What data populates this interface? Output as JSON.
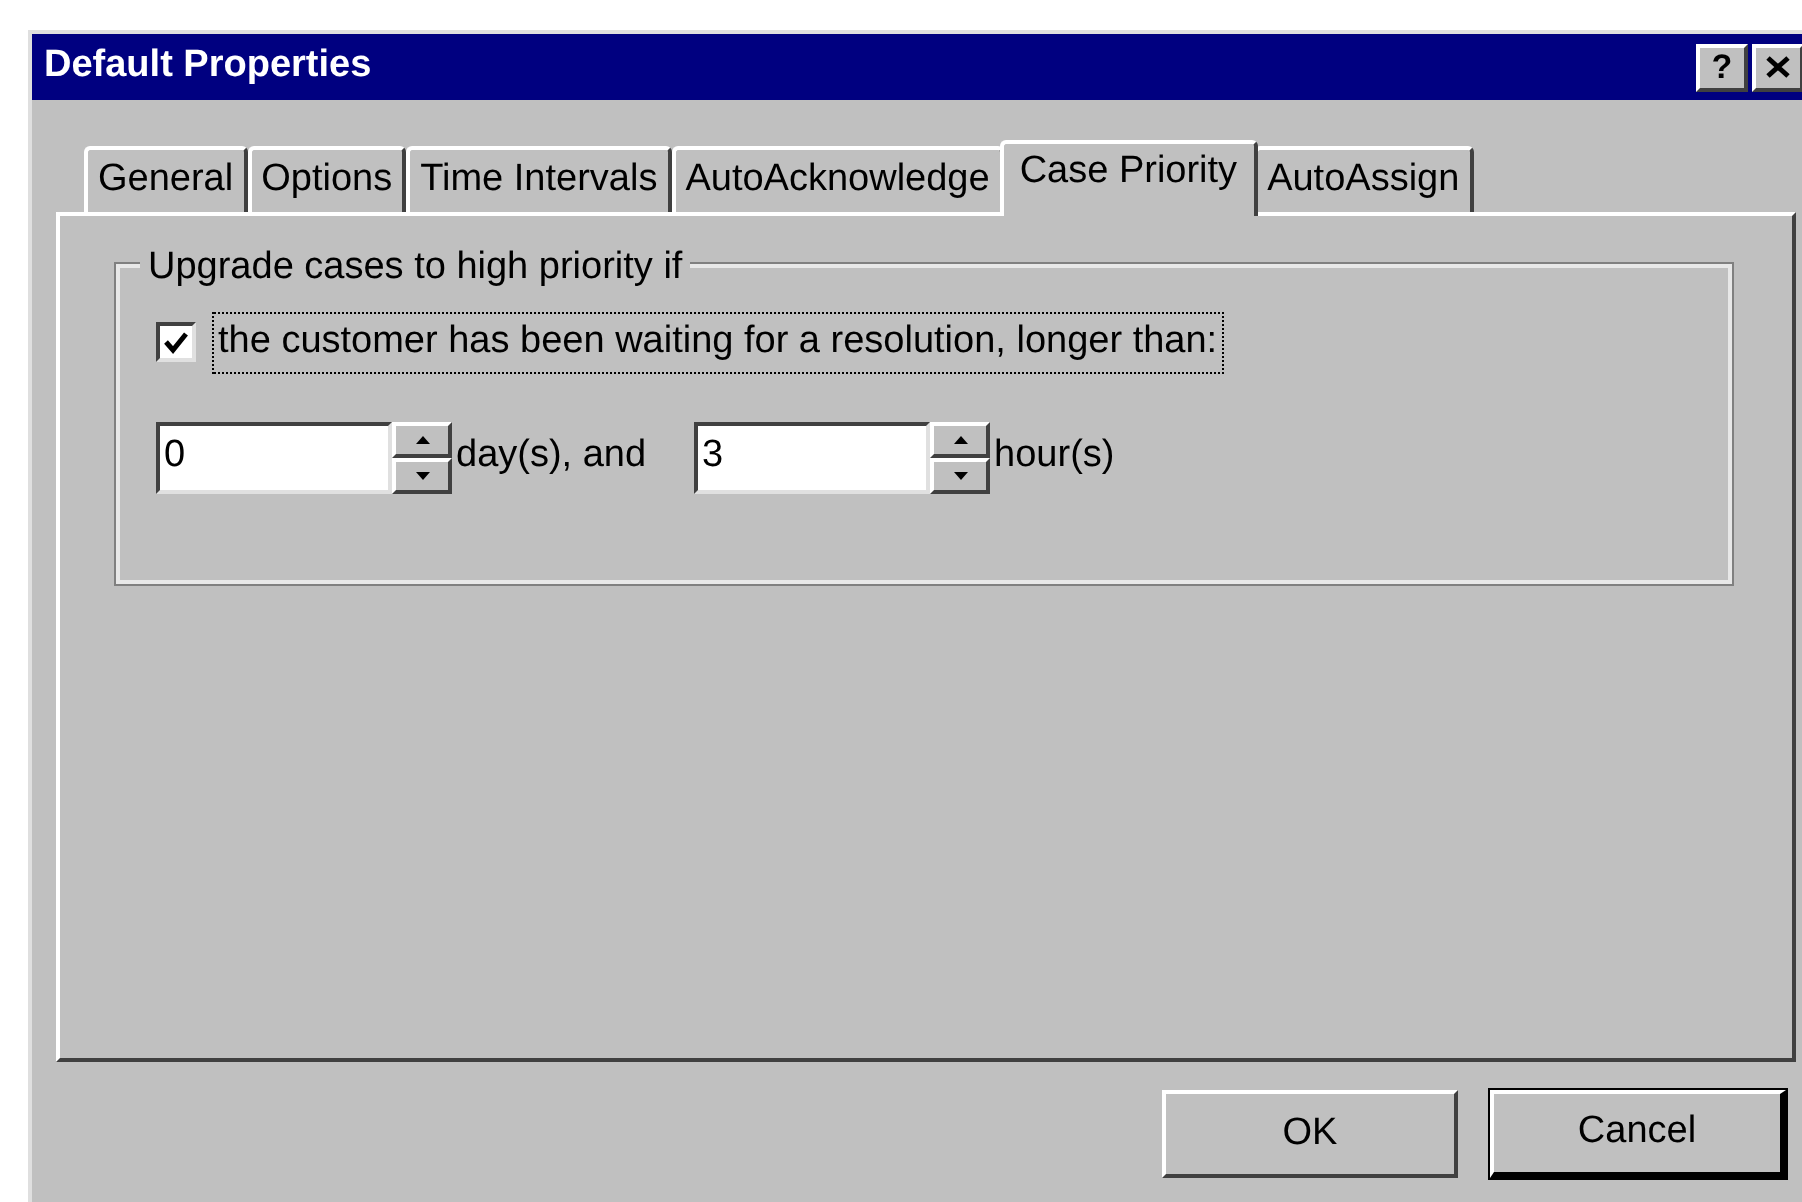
{
  "window": {
    "title": "Default Properties",
    "help_button": "?"
  },
  "tabs": [
    {
      "label": "General",
      "selected": false
    },
    {
      "label": "Options",
      "selected": false
    },
    {
      "label": "Time Intervals",
      "selected": false
    },
    {
      "label": "AutoAcknowledge",
      "selected": false
    },
    {
      "label": "Case Priority",
      "selected": true
    },
    {
      "label": "AutoAssign",
      "selected": false
    }
  ],
  "group": {
    "title": "Upgrade cases to high priority if",
    "checkbox": {
      "label": "the customer has been waiting for a resolution, longer than:",
      "checked": true
    },
    "spinners": [
      {
        "value": "0",
        "unit": "day(s), and"
      },
      {
        "value": "3",
        "unit": "hour(s)"
      }
    ]
  },
  "buttons": [
    {
      "label": "OK",
      "default": false
    },
    {
      "label": "Cancel",
      "default": true
    }
  ]
}
